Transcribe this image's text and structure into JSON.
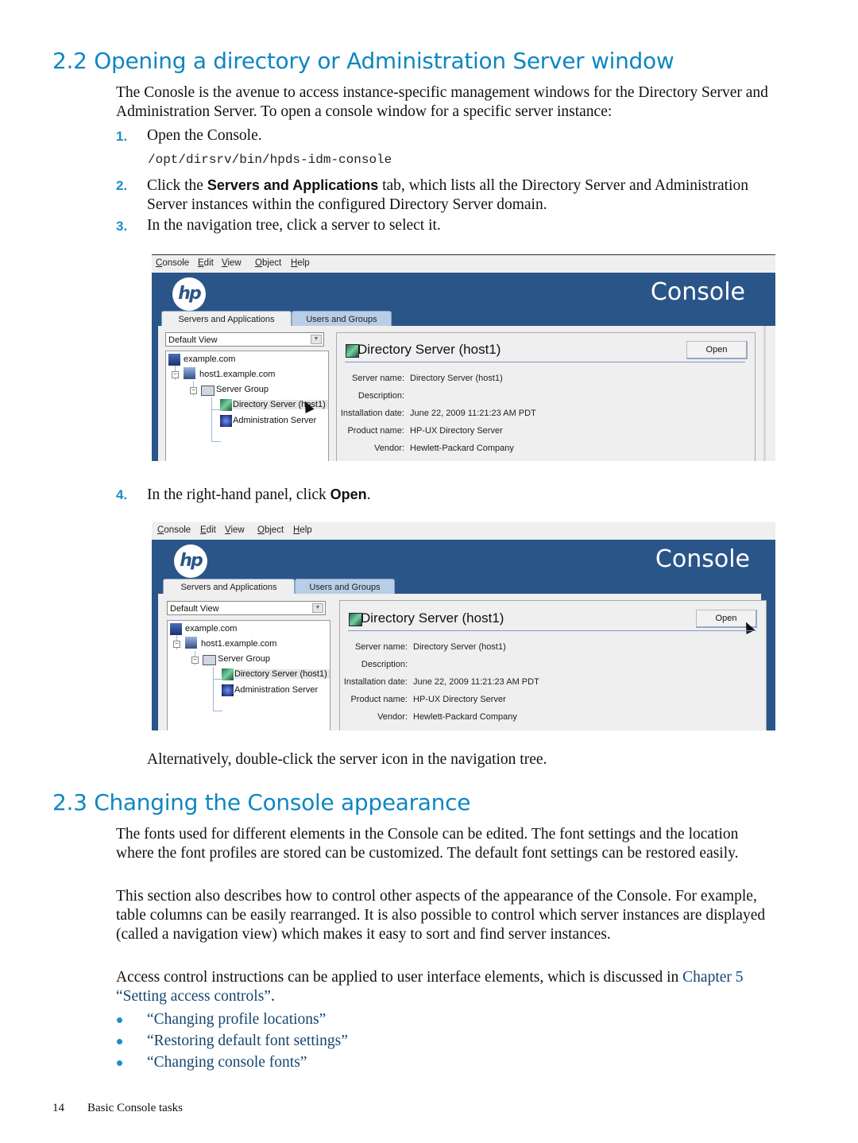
{
  "section_2_2": {
    "heading": "2.2 Opening a directory or Administration Server window",
    "intro": "The Conosle is the avenue to access instance-specific management windows for the Directory Server and Administration Server. To open a console window for a specific server instance:",
    "steps": [
      {
        "num": "1.",
        "text": "Open the Console."
      },
      {
        "num": "2.",
        "text_before": "Click the ",
        "bold": "Servers and Applications",
        "text_after": " tab, which lists all the Directory Server and Administration Server instances within the configured Directory Server domain."
      },
      {
        "num": "3.",
        "text": "In the navigation tree, click a server to select it."
      },
      {
        "num": "4.",
        "text_before": "In the right-hand panel, click ",
        "bold": "Open",
        "text_after": "."
      }
    ],
    "command": "/opt/dirsrv/bin/hpds-idm-console",
    "alternative": "Alternatively, double-click the server icon in the navigation tree."
  },
  "console": {
    "menu": [
      "Console",
      "Edit",
      "View",
      "Object",
      "Help"
    ],
    "menu_mnemonics": [
      "C",
      "E",
      "V",
      "O",
      "H"
    ],
    "logo": "hp",
    "banner_title": "Console",
    "tabs": [
      "Servers and Applications",
      "Users and Groups"
    ],
    "view_select": "Default View",
    "tree": {
      "domain": "example.com",
      "host": "host1.example.com",
      "group": "Server Group",
      "directory_server": "Directory Server (host1)",
      "admin_server": "Administration Server"
    },
    "detail": {
      "title": "Directory Server (host1)",
      "open_button": "Open",
      "fields": [
        {
          "label": "Server name:",
          "value": "Directory Server (host1)"
        },
        {
          "label": "Description:",
          "value": ""
        },
        {
          "label": "Installation date:",
          "value": "June 22, 2009 11:21:23 AM PDT"
        },
        {
          "label": "Product name:",
          "value": "HP-UX Directory Server"
        },
        {
          "label": "Vendor:",
          "value": "Hewlett-Packard Company"
        }
      ]
    }
  },
  "section_2_3": {
    "heading": "2.3 Changing the Console appearance",
    "para1": "The fonts used for different elements in the Console can be edited. The font settings and the location where the font profiles are stored can be customized. The default font settings can be restored easily.",
    "para2": "This section also describes how to control other aspects of the appearance of the Console. For example, table columns can be easily rearranged. It is also possible to control which server instances are displayed (called a navigation view) which makes it easy to sort and find server instances.",
    "para3": "Access control instructions can be applied to user interface elements, which is discussed in",
    "para3_link": "Chapter 5 “Setting access controls”",
    "para3_end": ".",
    "links": [
      "“Changing profile locations”",
      "“Restoring default font settings”",
      "“Changing console fonts”"
    ]
  },
  "footer": {
    "page_number": "14",
    "chapter": "Basic Console tasks"
  },
  "colors": {
    "heading": "#0e86c2",
    "link": "#15456e",
    "banner": "#2a5588"
  }
}
